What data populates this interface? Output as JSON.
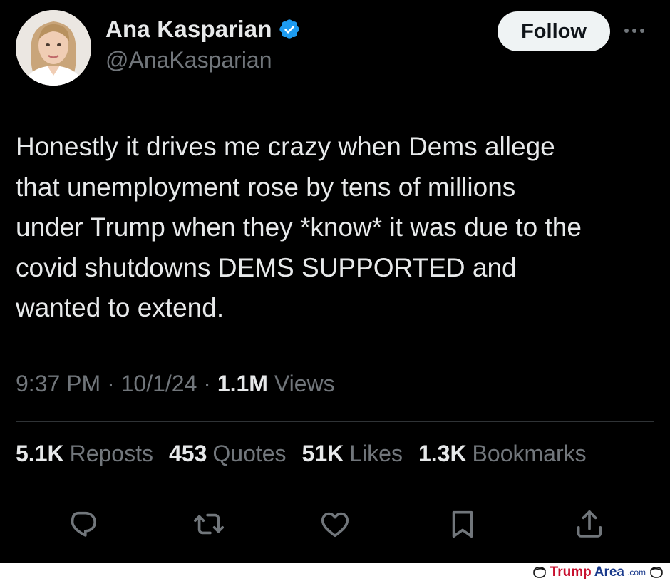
{
  "author": {
    "name": "Ana Kasparian",
    "handle": "@AnaKasparian",
    "verified": true
  },
  "follow_label": "Follow",
  "tweet": {
    "lines": [
      "Honestly it drives me crazy when Dems allege",
      "that unemployment rose by tens of millions",
      "under Trump when they *know* it was due to the",
      "covid shutdowns DEMS SUPPORTED and",
      "wanted to extend."
    ]
  },
  "meta": {
    "time": "9:37 PM",
    "sep1": " · ",
    "date": "10/1/24",
    "sep2": " · ",
    "views_count": "1.1M",
    "views_label": " Views"
  },
  "stats": [
    {
      "count": "5.1K",
      "label": "Reposts"
    },
    {
      "count": "453",
      "label": "Quotes"
    },
    {
      "count": "51K",
      "label": "Likes"
    },
    {
      "count": "1.3K",
      "label": "Bookmarks"
    }
  ],
  "actions": [
    "reply-icon",
    "repost-icon",
    "like-icon",
    "bookmark-icon",
    "share-icon"
  ],
  "colors": {
    "background": "#000000",
    "text": "#e7e9ea",
    "secondary": "#71767b",
    "verified": "#1d9bf0",
    "follow_bg": "#eff3f4"
  },
  "watermark": {
    "part1": "Trump",
    "part2": "Area",
    "part3": ".com"
  }
}
